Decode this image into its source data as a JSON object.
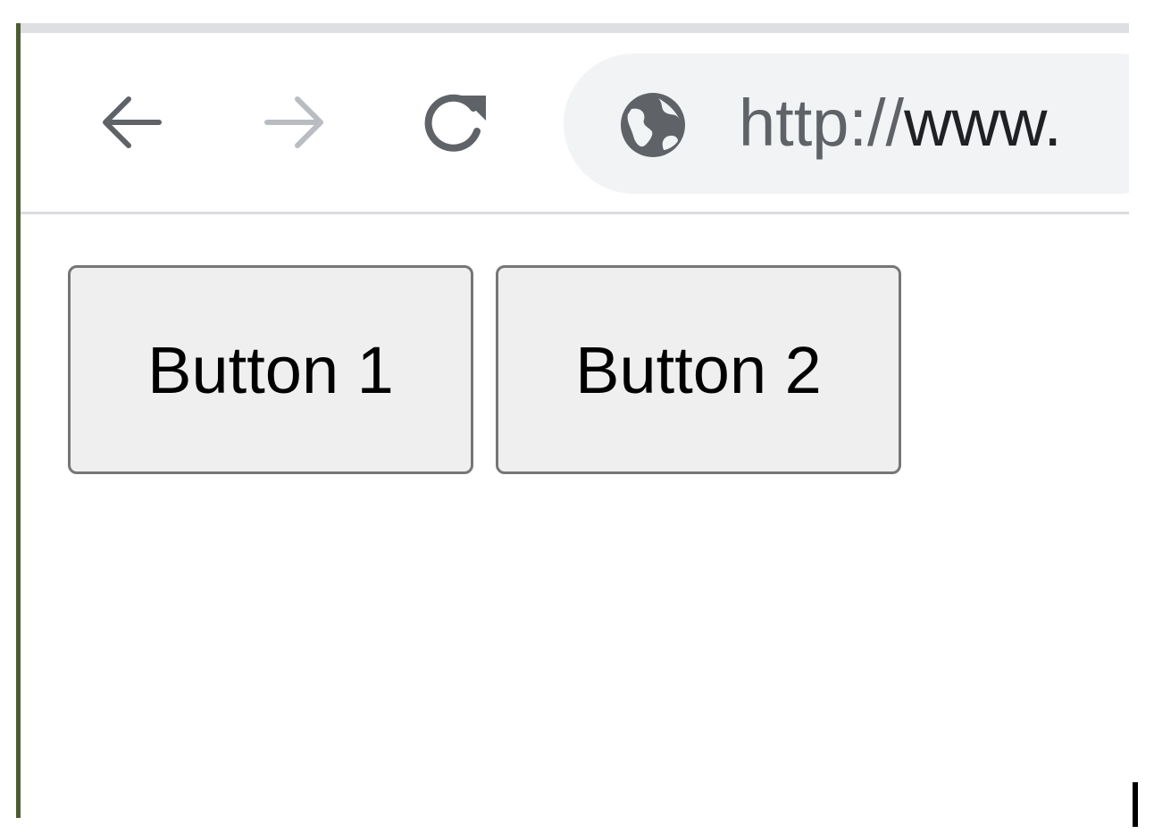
{
  "browser": {
    "url_scheme": "http://",
    "url_host_visible": "www.",
    "nav_icons": [
      "back-arrow-icon",
      "forward-arrow-icon",
      "reload-icon"
    ],
    "site_icon": "globe-icon",
    "forward_enabled": false,
    "colors": {
      "toolbar_bg": "#ffffff",
      "omnibox_bg": "#f1f3f4",
      "icon_active": "#5f6368",
      "icon_disabled": "#b9bcc0",
      "url_host": "#202124"
    }
  },
  "page": {
    "buttons": [
      {
        "label": "Button 1"
      },
      {
        "label": "Button 2"
      }
    ],
    "colors": {
      "button_bg": "#efefef",
      "button_border": "#767676"
    }
  }
}
